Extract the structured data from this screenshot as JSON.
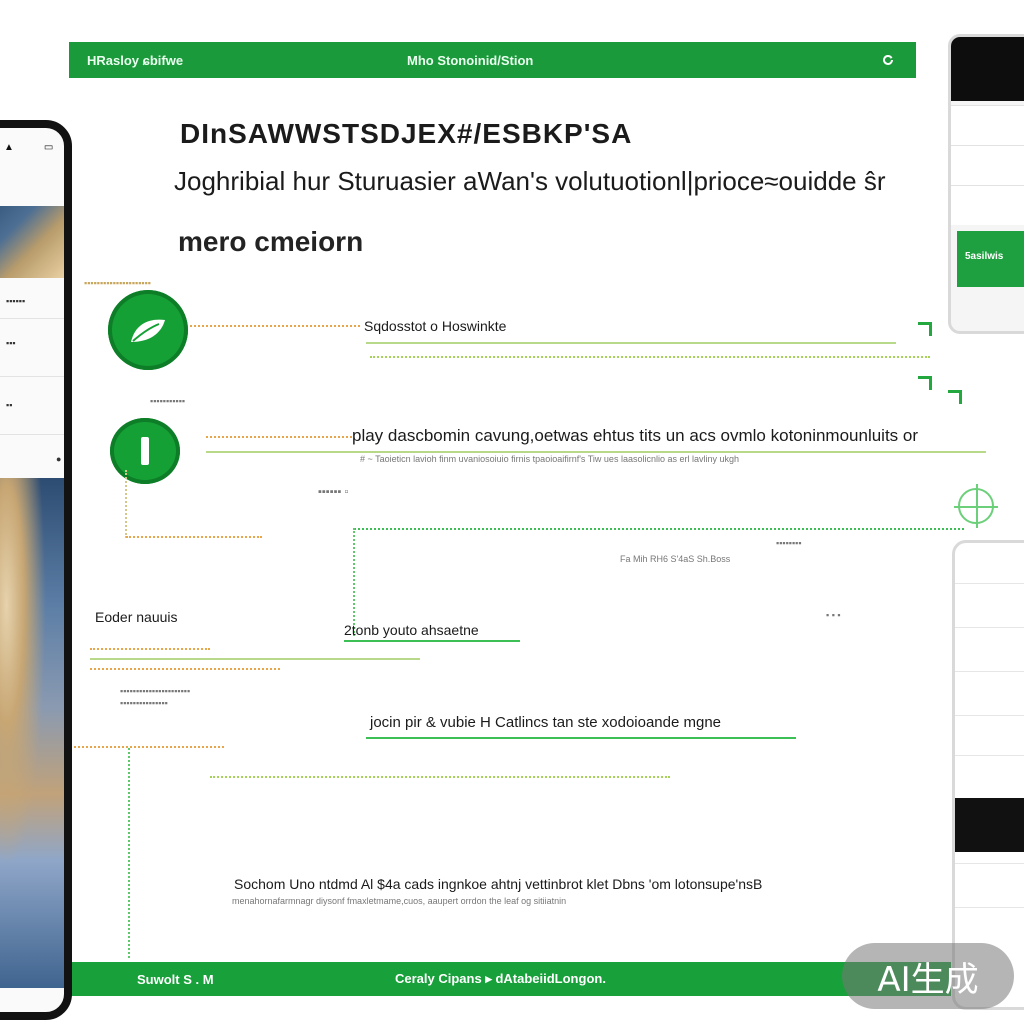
{
  "header": {
    "left_text": "HRasloy ɕbifwe",
    "center_text": "Mho Stonoinid/Stion",
    "icon": "refresh-icon"
  },
  "hero": {
    "headline": "DInSAWWSTSDJEX#/ESBKP'SA",
    "subhead": "Joghribial hur Sturuasier aWan's volutuotionl|prioce≈ouidde ŝr",
    "micro": "mero cmeiorn"
  },
  "callouts": {
    "first_label": "Sqdosstot o Hoswinkte",
    "second_label": "play dascbomin cavung,oetwas ehtus tits un acs ovmlo kotoninmounluits or",
    "second_sub": "# ~ Taoieticn  lavioh finm uvaniosoiuio  firnis  tpaoioaifirnf's Tiw ues laasolicnlio  as erl lavliny ukgh",
    "mid_small": "Fa Mih RH6 S'4aS Sh.Boss",
    "bottom_label": "2tonb youto ahsaetne",
    "left_label": "Eoder nauuis",
    "caption": "jocin pir & vubie H Catlincs tan ste xodoioande mgne",
    "footer_line": "Sochom Uno ntdmd Al $4a cads ingnkoe ahtnj vettinbrot klet Dbns 'om lotonsupe'nsB",
    "footer_sub": "menahornafarmnagr diysonf fmaxletmame,cuos, aaupert orrdon the leaf og sitiiatnin"
  },
  "footer": {
    "left_text": "Suwolt S . M",
    "center_text": "Ceraly Cipans ▸ dAtabeiidLongon."
  },
  "right_panel": {
    "green_button": "5asilwis"
  },
  "watermark": "AI生成",
  "colors": {
    "brand_green": "#1a9a3a",
    "accent_green": "#15a035",
    "text_dark": "#1b1b1b"
  }
}
